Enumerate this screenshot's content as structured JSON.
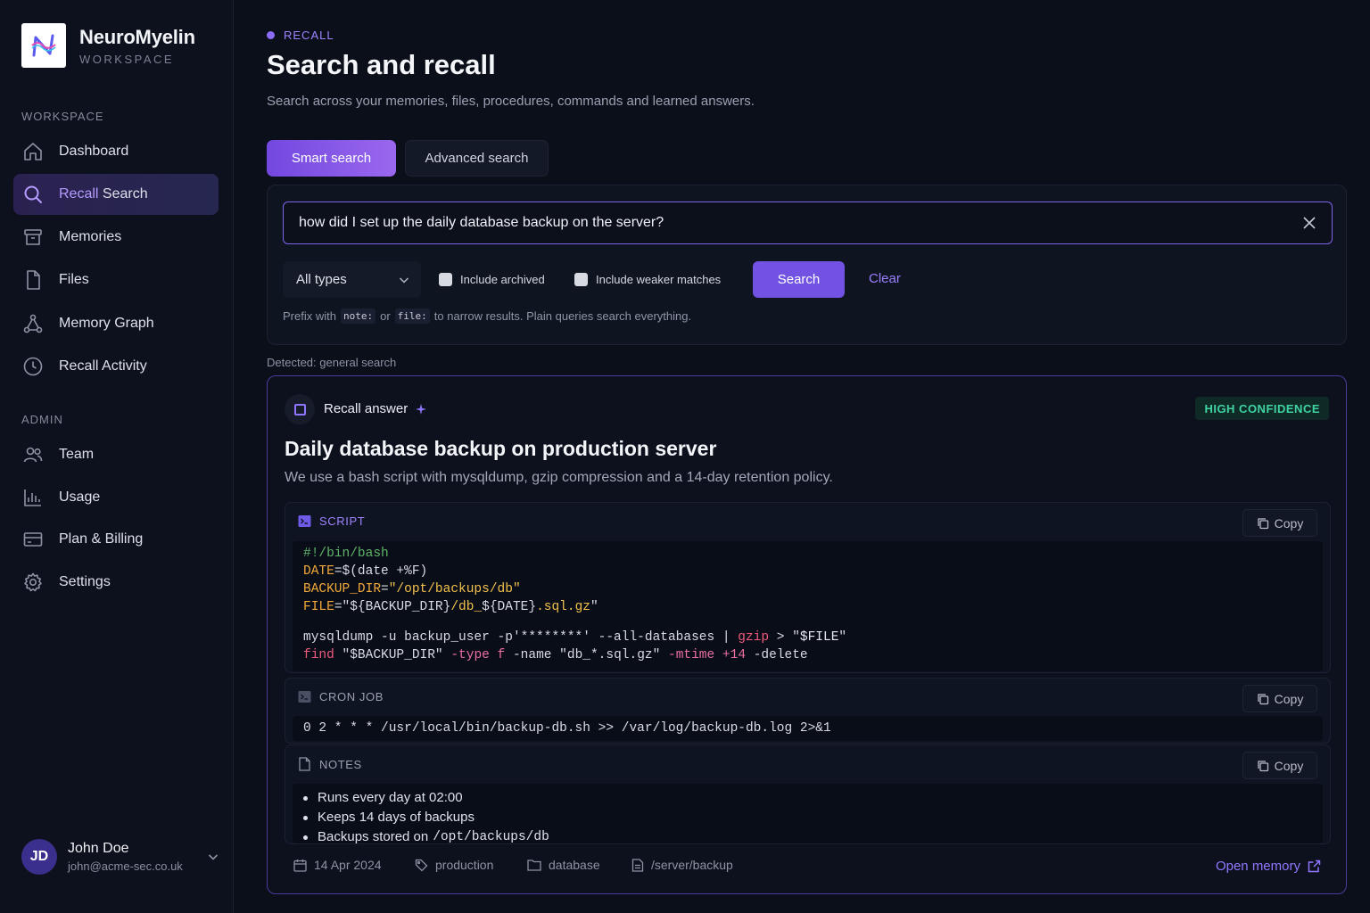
{
  "brand": {
    "name": "NeuroMyelin",
    "sub": "WORKSPACE"
  },
  "sidebar": {
    "workspace_label": "WORKSPACE",
    "admin_label": "ADMIN",
    "items": [
      {
        "label": "Dashboard",
        "icon": "home-icon"
      },
      {
        "label_a": "Recall",
        "label_b": " Search",
        "icon": "search-icon",
        "active": true
      },
      {
        "label": "Memories",
        "icon": "archive-icon"
      },
      {
        "label": "Files",
        "icon": "file-icon"
      },
      {
        "label": "Memory Graph",
        "icon": "graph-icon"
      },
      {
        "label": "Recall Activity",
        "icon": "clock-icon"
      }
    ],
    "admin_items": [
      {
        "label": "Team",
        "icon": "users-icon"
      },
      {
        "label": "Usage",
        "icon": "bar-chart-icon"
      },
      {
        "label": "Plan & Billing",
        "icon": "credit-card-icon"
      },
      {
        "label": "Settings",
        "icon": "gear-icon"
      }
    ]
  },
  "user": {
    "initials": "JD",
    "name": "John Doe",
    "email": "john@acme-sec.co.uk"
  },
  "header": {
    "eyebrow": "RECALL",
    "title": "Search and recall",
    "subtitle": "Search across your memories, files, procedures, commands and learned answers."
  },
  "tabs": {
    "smart": "Smart search",
    "advanced": "Advanced search"
  },
  "search": {
    "query": "how did I set up the daily database backup on the server?",
    "type_select": "All types",
    "include_archived": "Include archived",
    "include_weaker": "Include weaker matches",
    "search_label": "Search",
    "clear_label": "Clear",
    "hint_a": "Prefix with",
    "hint_code1": "note:",
    "hint_or": "or",
    "hint_code2": "file:",
    "hint_b": "to narrow results. Plain queries search everything."
  },
  "detected": "Detected: general search",
  "answer": {
    "label": "Recall answer",
    "confidence": "HIGH CONFIDENCE",
    "title": "Daily database backup on production server",
    "description": "We use a bash script with mysqldump, gzip compression and a 14-day retention policy.",
    "script_label": "SCRIPT",
    "cron_label": "CRON JOB",
    "notes_label": "NOTES",
    "copy_label": "Copy",
    "script": {
      "l1": "#!/bin/bash",
      "l2a": "DATE",
      "l2b": "=$(date +%F)",
      "l3a": "BACKUP_DIR",
      "l3b": "=",
      "l3c": "\"/opt/backups/db\"",
      "l4a": "FILE",
      "l4b": "=\"${BACKUP_DIR}",
      "l4c": "/db_",
      "l4d": "${DATE}",
      "l4e": ".sql.gz",
      "l4f": "\"",
      "l5a": "mysqldump -u backup_user -p'********' --all-databases | ",
      "l5b": "gzip",
      "l5c": " > \"",
      "l5d": "$FILE",
      "l5e": "\"",
      "l6a": "find",
      "l6b": " \"$BACKUP_DIR\" ",
      "l6c": "-type f",
      "l6d": " -name \"db_*.sql.gz\" ",
      "l6e": "-mtime +14",
      "l6f": " -delete"
    },
    "cron": "0 2 * * * /usr/local/bin/backup-db.sh >> /var/log/backup-db.log 2>&1",
    "notes": [
      {
        "text": "Runs every day at 02:00"
      },
      {
        "text": "Keeps 14 days of backups"
      },
      {
        "text": "Backups stored on",
        "code": "/opt/backups/db"
      }
    ],
    "meta": {
      "date": "14 Apr 2024",
      "tag": "production",
      "folder": "database",
      "path": "/server/backup"
    },
    "open_label": "Open memory"
  },
  "colors": {
    "accent": "#7c5cf0",
    "confidence": "#3fd3a2",
    "background": "#0b0f1a"
  }
}
